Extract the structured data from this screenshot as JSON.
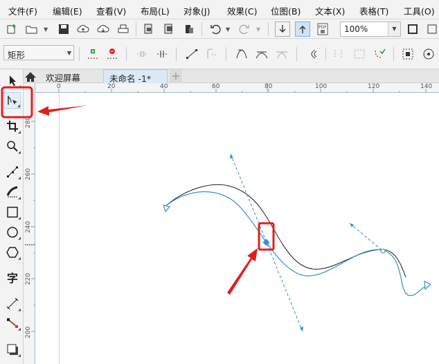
{
  "menu": [
    "文件(F)",
    "编辑(E)",
    "查看(V)",
    "布局(L)",
    "对象(J)",
    "效果(C)",
    "位图(B)",
    "文本(X)",
    "表格(T)",
    "工具(O)"
  ],
  "toolbar": {
    "zoom_value": "100%"
  },
  "property_bar": {
    "shape_type": "矩形"
  },
  "tabs": {
    "home_label": "欢迎屏幕",
    "doc_label": "未命名 -1*",
    "add_label": "+"
  },
  "ruler_top": [
    "0",
    "20",
    "40",
    "60",
    "80",
    "100",
    "120",
    "140"
  ],
  "ruler_left": [
    "280",
    "260",
    "240",
    "220",
    "200"
  ],
  "tools": {
    "text_glyph": "字"
  },
  "colors": {
    "accent_blue": "#2f8fd2",
    "annotation_red": "#e02020",
    "black_curve": "#1a1a1a"
  },
  "icons": [
    "pick-tool-icon",
    "shape-tool-icon",
    "crop-icon",
    "zoom-icon",
    "freehand-icon",
    "artistic-media-icon",
    "rectangle-icon",
    "ellipse-icon",
    "polygon-icon",
    "text-tool-icon",
    "parallel-dimension-icon",
    "connector-icon",
    "drop-shadow-icon"
  ]
}
